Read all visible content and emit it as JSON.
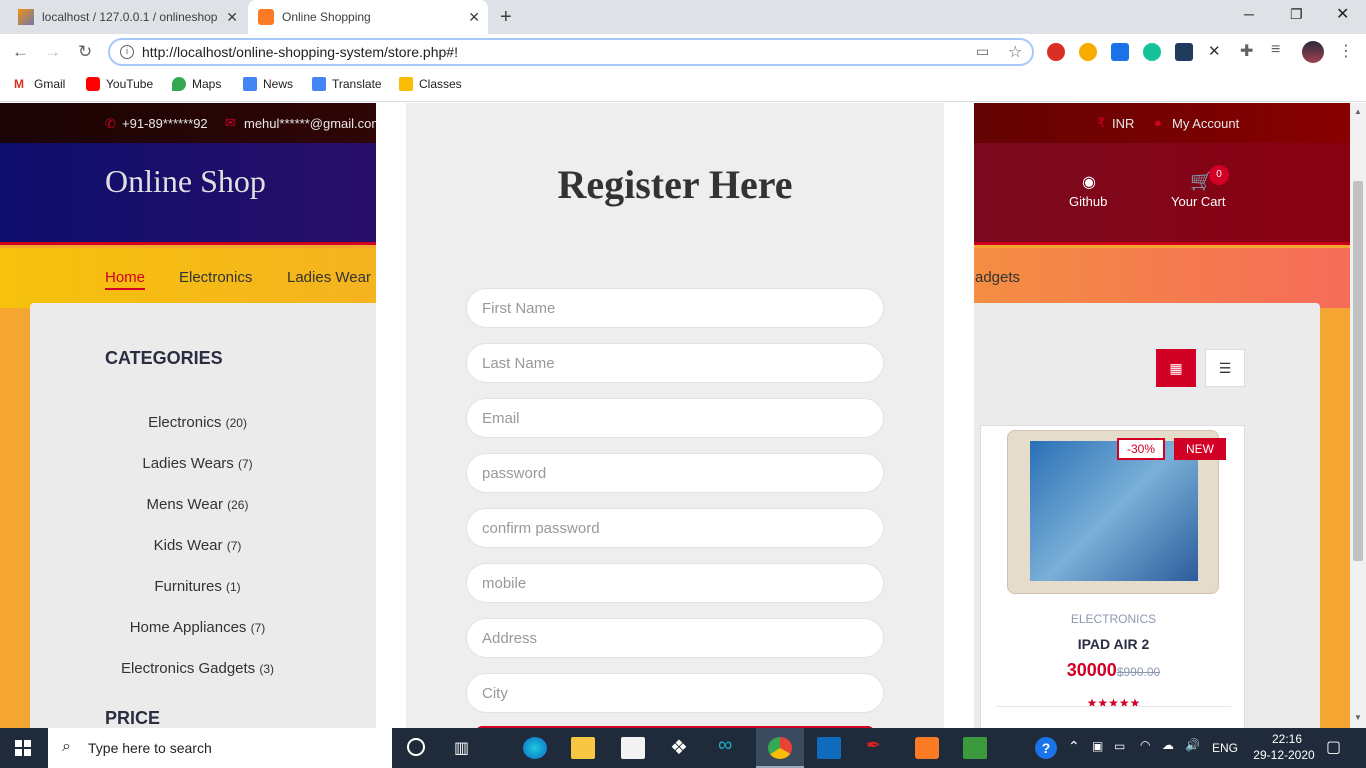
{
  "browser": {
    "tabs": [
      {
        "title": "localhost / 127.0.0.1 / onlineshop"
      },
      {
        "title": "Online Shopping"
      }
    ],
    "url": "http://localhost/online-shopping-system/store.php#!",
    "bookmarks": [
      "Gmail",
      "YouTube",
      "Maps",
      "News",
      "Translate",
      "Classes"
    ]
  },
  "site": {
    "phone": "+91-89******92",
    "email": "mehul******@gmail.com",
    "currency": "INR",
    "account": "My Account",
    "logo": "Online Shop",
    "github": "Github",
    "cart": "Your Cart",
    "cart_count": "0",
    "nav": [
      "Home",
      "Electronics",
      "Ladies Wear",
      "adgets"
    ],
    "categories_title": "CATEGORIES",
    "categories": [
      {
        "name": "Electronics",
        "count": "(20)"
      },
      {
        "name": "Ladies Wears",
        "count": "(7)"
      },
      {
        "name": "Mens Wear",
        "count": "(26)"
      },
      {
        "name": "Kids Wear",
        "count": "(7)"
      },
      {
        "name": "Furnitures",
        "count": "(1)"
      },
      {
        "name": "Home Appliances",
        "count": "(7)"
      },
      {
        "name": "Electronics Gadgets",
        "count": "(3)"
      }
    ],
    "price_title": "PRICE",
    "product": {
      "discount": "-30%",
      "badge": "NEW",
      "category": "ELECTRONICS",
      "name": "IPAD AIR 2",
      "price": "30000",
      "old_price": "$990.00",
      "rating": 5
    }
  },
  "modal": {
    "title": "Register Here",
    "fields": [
      "First Name",
      "Last Name",
      "Email",
      "password",
      "confirm password",
      "mobile",
      "Address",
      "City"
    ]
  },
  "taskbar": {
    "search_placeholder": "Type here to search",
    "lang": "ENG",
    "time": "22:16",
    "date": "29-12-2020"
  },
  "colors": {
    "accent": "#d10024",
    "omnibox_border": "#a8c7fa"
  }
}
